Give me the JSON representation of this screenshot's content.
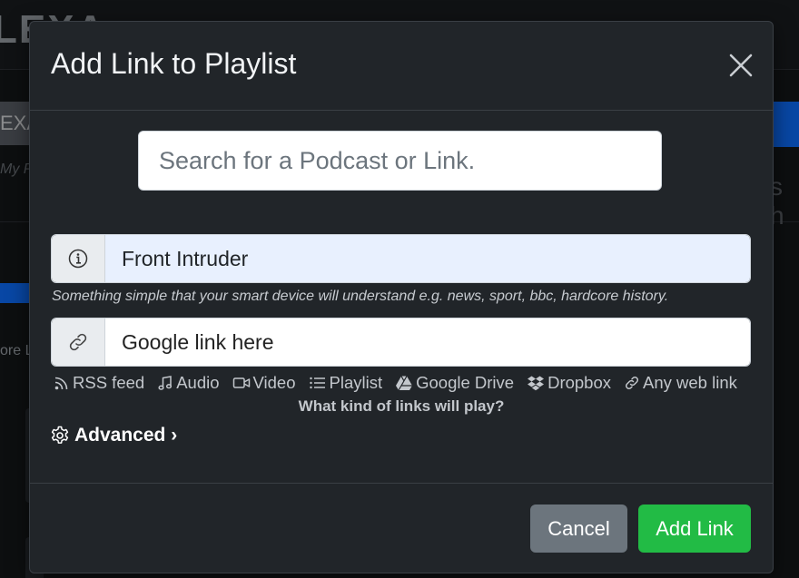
{
  "background": {
    "logo_text": "LEXA",
    "pill_text": "EXA",
    "sub_text": "My Po",
    "small_text": "ore L",
    "right_text": "s h"
  },
  "modal": {
    "title": "Add Link to Playlist",
    "search": {
      "placeholder": "Search for a Podcast or Link.",
      "value": ""
    },
    "name_field": {
      "value": "Front Intruder",
      "icon": "info-icon"
    },
    "help_text": "Something simple that your smart device will understand e.g. news, sport, bbc, hardcore history.",
    "link_field": {
      "placeholder": "Google link here",
      "value": "",
      "icon": "link-icon"
    },
    "link_types": [
      {
        "label": "RSS feed",
        "icon": "rss-icon"
      },
      {
        "label": "Audio",
        "icon": "music-icon"
      },
      {
        "label": "Video",
        "icon": "video-icon"
      },
      {
        "label": "Playlist",
        "icon": "list-icon"
      },
      {
        "label": "Google Drive",
        "icon": "google-drive-icon"
      },
      {
        "label": "Dropbox",
        "icon": "dropbox-icon"
      },
      {
        "label": "Any web link",
        "icon": "link-icon"
      }
    ],
    "what_links": "What kind of links will play?",
    "advanced": "Advanced ›",
    "buttons": {
      "cancel": "Cancel",
      "add": "Add Link"
    }
  },
  "colors": {
    "modal_bg": "#212529",
    "cancel": "#6c757d",
    "add": "#22bb45",
    "autofill": "#e8f0fe"
  }
}
